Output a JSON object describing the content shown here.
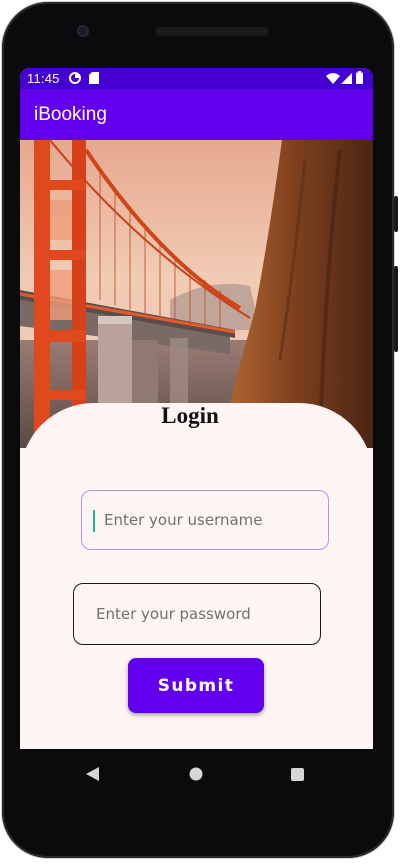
{
  "status_bar": {
    "time": "11:45",
    "left_icons": [
      "data-saver-icon",
      "sd-card-icon"
    ],
    "right_icons": [
      "wifi-icon",
      "cell-signal-icon",
      "battery-icon"
    ],
    "color": "#4400d0"
  },
  "app_bar": {
    "title": "iBooking",
    "color": "#6200ee"
  },
  "hero": {
    "subject": "golden-gate-bridge-photo"
  },
  "login": {
    "title": "Login",
    "username": {
      "value": "",
      "placeholder": "Enter your username"
    },
    "password": {
      "value": "",
      "placeholder": "Enter your password"
    },
    "submit_label": "Submit",
    "accent": "#6200ee",
    "card_color": "#fcf5f4"
  },
  "nav_bar": {
    "buttons": [
      "back-icon",
      "home-icon",
      "recents-icon"
    ]
  }
}
